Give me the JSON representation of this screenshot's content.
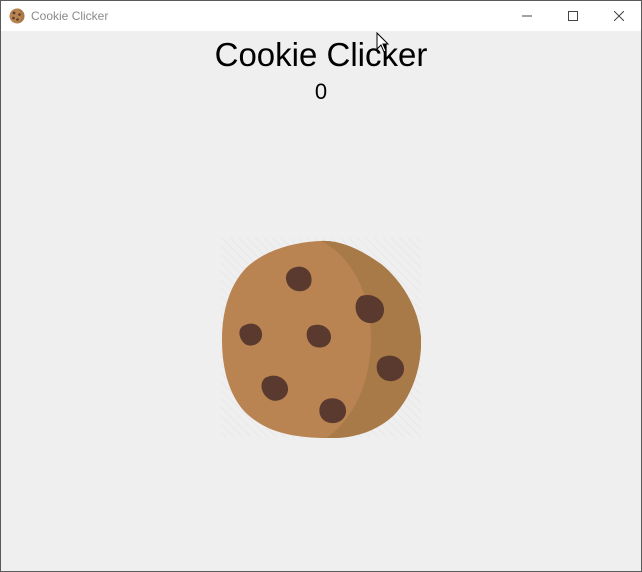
{
  "window": {
    "title": "Cookie Clicker",
    "icon": "cookie-icon",
    "controls": [
      "minimize-icon",
      "maximize-icon",
      "close-icon"
    ]
  },
  "app": {
    "heading": "Cookie Clicker",
    "cookie_count": "0",
    "cookie_button_icon": "cookie-icon"
  },
  "colors": {
    "cookie_light": "#b98452",
    "cookie_dark": "#a87a48",
    "chip": "#5a3a2e",
    "background": "#efefef"
  }
}
